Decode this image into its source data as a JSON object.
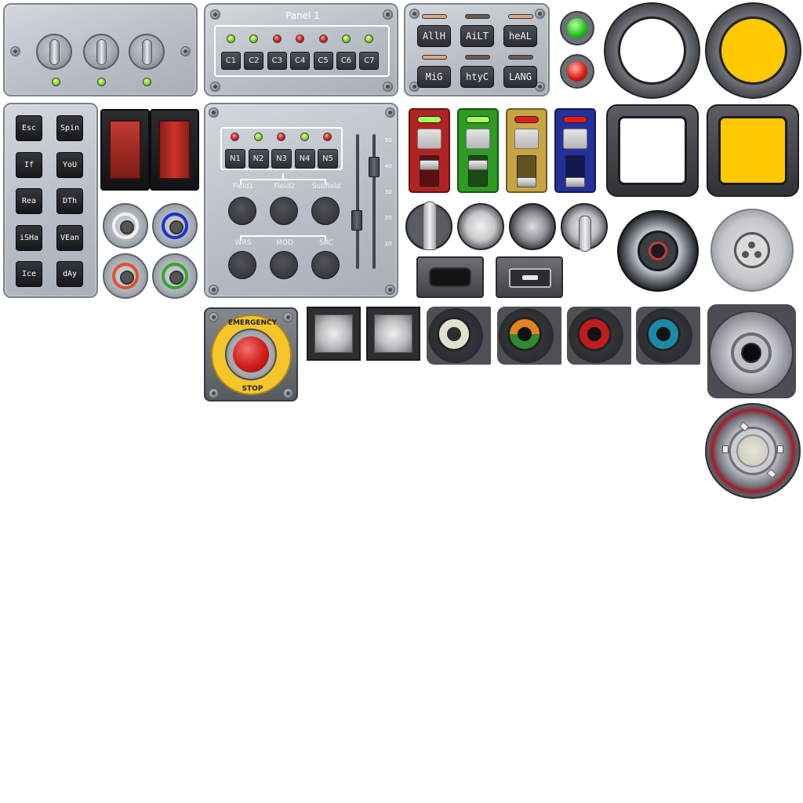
{
  "panel1": {
    "title": "Panel 1"
  },
  "channel_strip": {
    "labels": [
      "C1",
      "C2",
      "C3",
      "C4",
      "C5",
      "C6",
      "C7"
    ],
    "leds": [
      "green",
      "green",
      "red",
      "red",
      "red",
      "green",
      "green"
    ]
  },
  "mode_keys": {
    "labels": [
      "AllH",
      "AiLT",
      "heAL",
      "MiG",
      "htyC",
      "LANG"
    ]
  },
  "side_keys": {
    "labels": [
      "Esc",
      "Spin",
      "If",
      "YoU",
      "Rea",
      "DTh",
      "iSHa",
      "VEan",
      "Ice",
      "dAy"
    ]
  },
  "mixer": {
    "labels": [
      "N1",
      "N2",
      "N3",
      "N4",
      "N5"
    ],
    "leds": [
      "red",
      "green",
      "red",
      "green",
      "red"
    ],
    "field_labels": [
      "Field1",
      "Field2",
      "Subfield"
    ],
    "mode_labels": [
      "WRS",
      "MOD",
      "SRC"
    ],
    "fader_scale": [
      "50",
      "40",
      "30",
      "20",
      "10"
    ]
  },
  "emergency": {
    "top": "EMERGENCY",
    "bottom": "STOP"
  },
  "colors": {
    "led_green": "#5fd31c",
    "led_red": "#e01d12",
    "yellow": "#ffc800",
    "toggle_red": "#b32223",
    "toggle_green": "#2f9a24",
    "toggle_yellow": "#c7a542",
    "toggle_blue": "#26309a"
  }
}
